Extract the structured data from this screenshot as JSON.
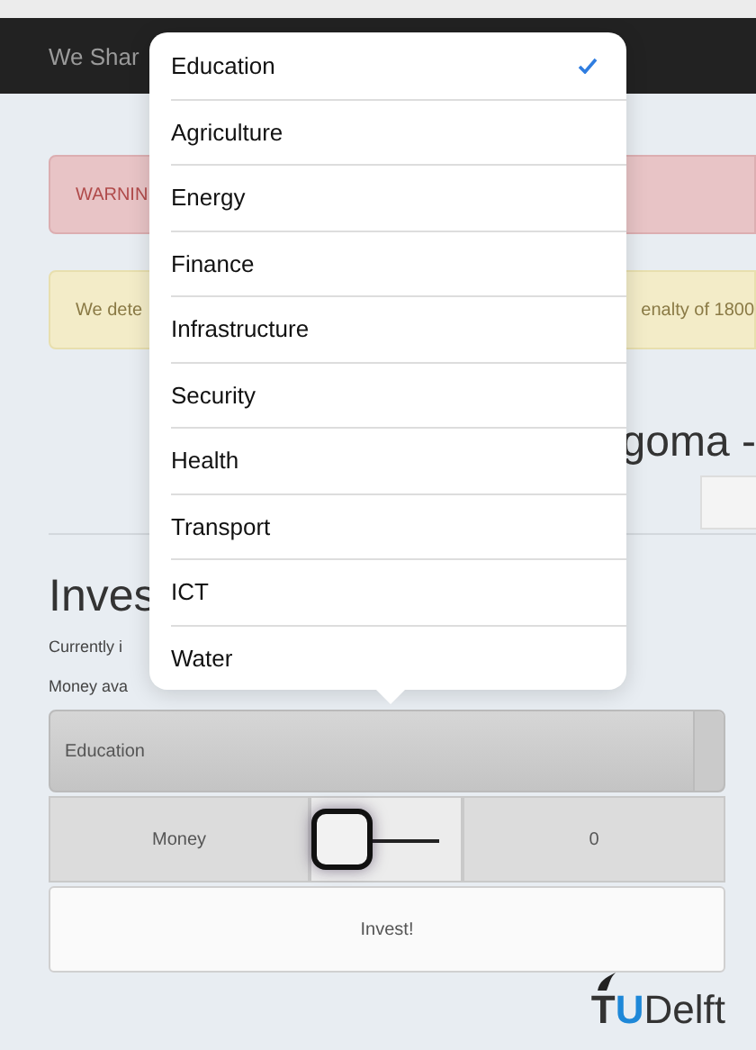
{
  "navbar": {
    "title": "We Shar"
  },
  "alerts": [
    {
      "kind": "danger",
      "text": "WARNIN"
    },
    {
      "kind": "warning",
      "text": "We dete",
      "text_right": "enalty of 1800"
    }
  ],
  "heading": "goma -",
  "invest": {
    "title": "Inves",
    "currently": "Currently i",
    "money": "Money ava",
    "select": {
      "value": "Education"
    },
    "row": {
      "label": "Money",
      "slider": {
        "level": 0
      },
      "value": "0"
    },
    "button": "Invest!"
  },
  "logo": {
    "text": "TUDelft"
  },
  "popover": {
    "items": [
      {
        "label": "Education",
        "selected": true
      },
      {
        "label": "Agriculture",
        "selected": false
      },
      {
        "label": "Energy",
        "selected": false
      },
      {
        "label": "Finance",
        "selected": false
      },
      {
        "label": "Infrastructure",
        "selected": false
      },
      {
        "label": "Security",
        "selected": false
      },
      {
        "label": "Health",
        "selected": false
      },
      {
        "label": "Transport",
        "selected": false
      },
      {
        "label": "ICT",
        "selected": false
      },
      {
        "label": "Water",
        "selected": false
      }
    ]
  }
}
